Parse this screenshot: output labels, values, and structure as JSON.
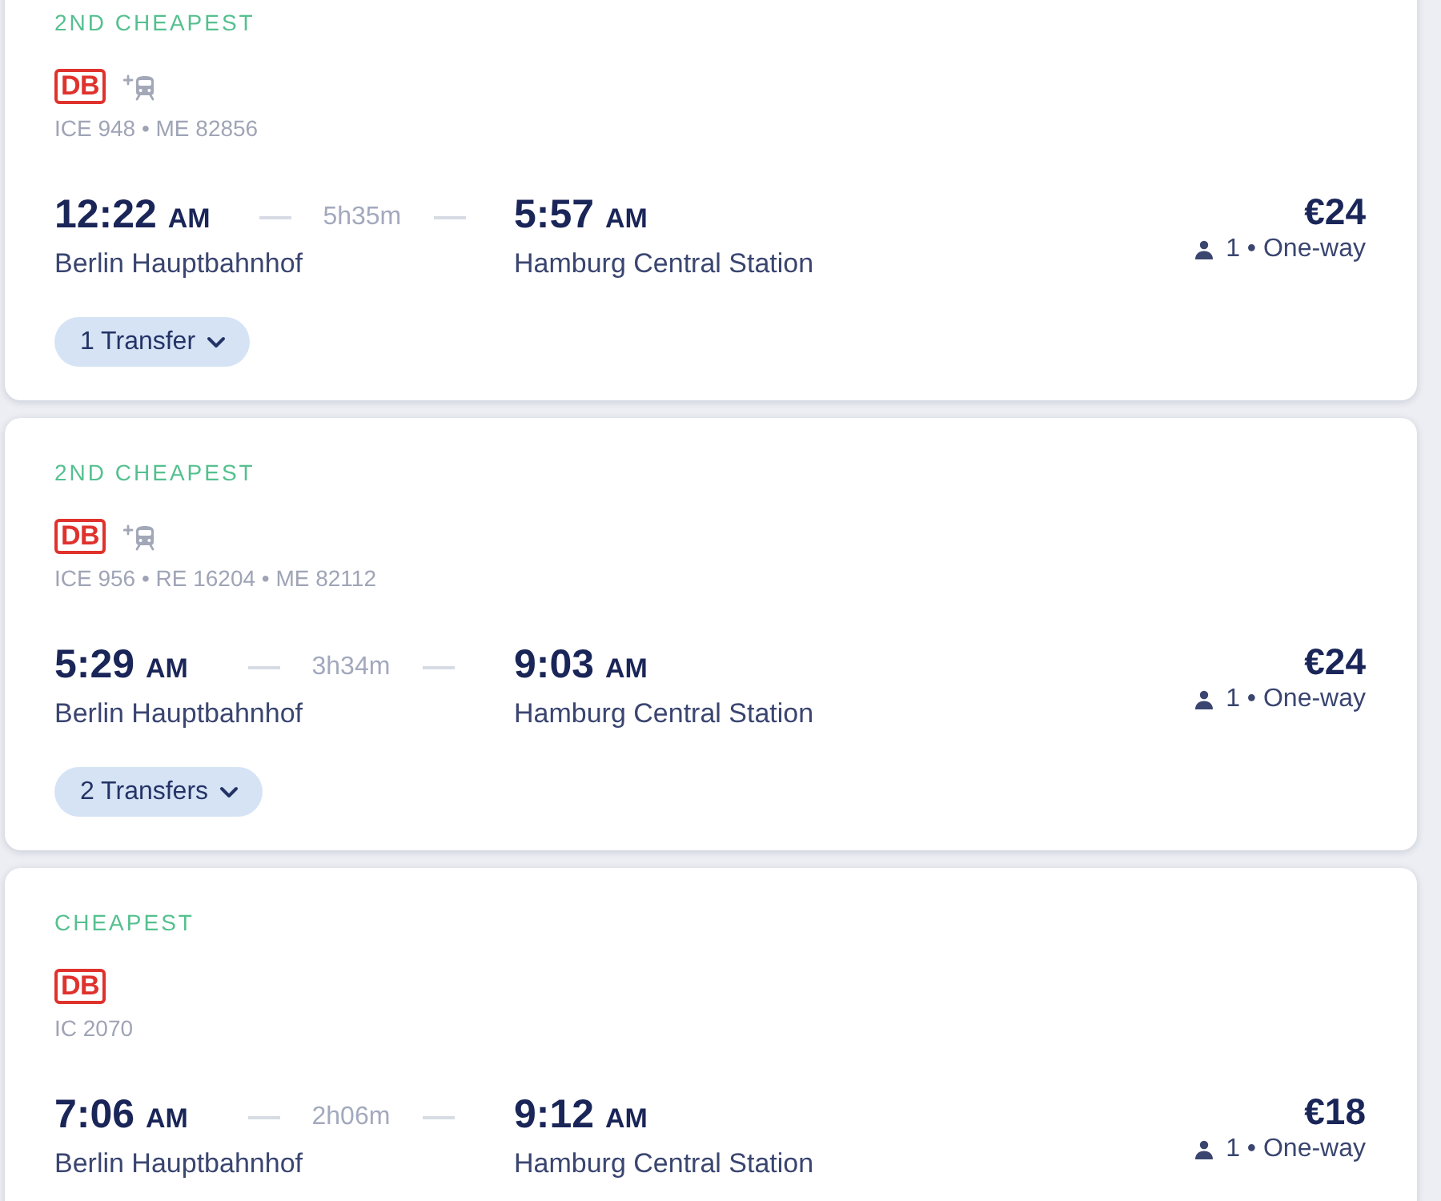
{
  "results": [
    {
      "tag": "2ND CHEAPEST",
      "operators": [
        {
          "kind": "logo",
          "text": "DB"
        },
        {
          "kind": "more"
        }
      ],
      "trains": "ICE 948 • ME 82856",
      "departure": {
        "time": "12:22",
        "period": "AM",
        "station": "Berlin Hauptbahnhof"
      },
      "duration": "5h35m",
      "arrival": {
        "time": "5:57",
        "period": "AM",
        "station": "Hamburg Central Station"
      },
      "price": "€24",
      "fare_note": "1 • One-way",
      "transfers": {
        "label": "1 Transfer",
        "expanded": false
      }
    },
    {
      "tag": "2ND CHEAPEST",
      "operators": [
        {
          "kind": "logo",
          "text": "DB"
        },
        {
          "kind": "more"
        }
      ],
      "trains": "ICE 956 • RE 16204 • ME 82112",
      "departure": {
        "time": "5:29",
        "period": "AM",
        "station": "Berlin Hauptbahnhof"
      },
      "duration": "3h34m",
      "arrival": {
        "time": "9:03",
        "period": "AM",
        "station": "Hamburg Central Station"
      },
      "price": "€24",
      "fare_note": "1 • One-way",
      "transfers": {
        "label": "2 Transfers",
        "expanded": false
      }
    },
    {
      "tag": "CHEAPEST",
      "operators": [
        {
          "kind": "logo",
          "text": "DB"
        }
      ],
      "trains": "IC 2070",
      "departure": {
        "time": "7:06",
        "period": "AM",
        "station": "Berlin Hauptbahnhof"
      },
      "duration": "2h06m",
      "arrival": {
        "time": "9:12",
        "period": "AM",
        "station": "Hamburg Central Station"
      },
      "price": "€18",
      "fare_note": "1 • One-way"
    }
  ]
}
